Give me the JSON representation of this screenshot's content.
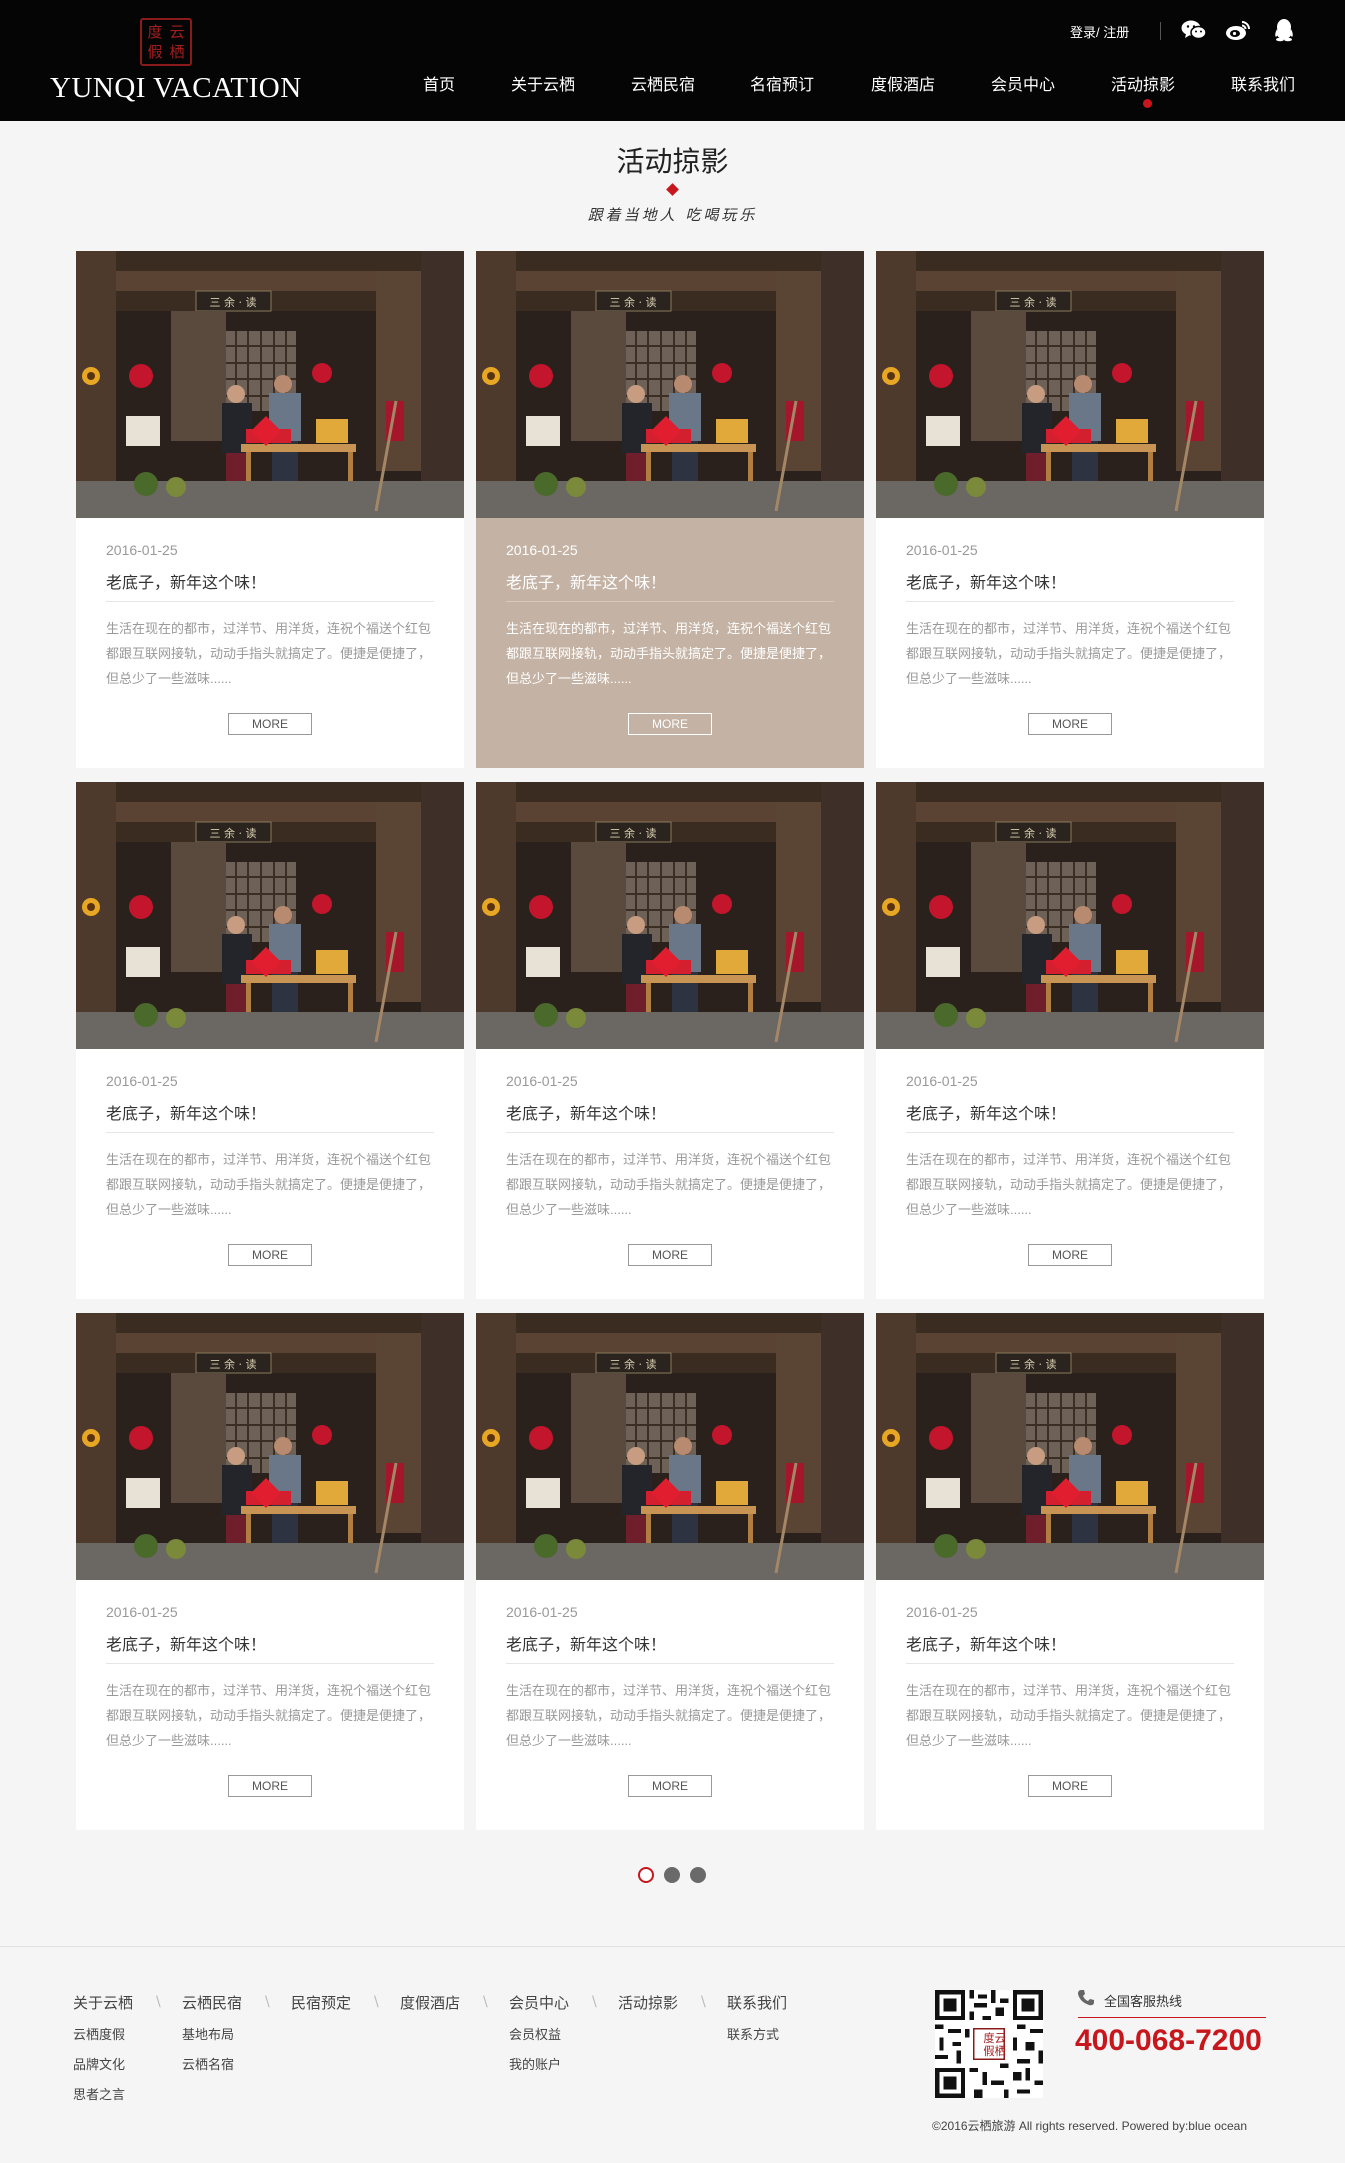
{
  "header": {
    "logo_seal": [
      "度",
      "云",
      "假",
      "栖"
    ],
    "logo_text": "YUNQI VACATION",
    "login": "登录",
    "slash": "/",
    "register": "注册",
    "icons": [
      "wechat-icon",
      "weibo-icon",
      "qq-icon"
    ]
  },
  "nav": {
    "items": [
      {
        "label": "首页"
      },
      {
        "label": "关于云栖"
      },
      {
        "label": "云栖民宿"
      },
      {
        "label": "名宿预订"
      },
      {
        "label": "度假酒店"
      },
      {
        "label": "会员中心"
      },
      {
        "label": "活动掠影"
      },
      {
        "label": "联系我们"
      }
    ],
    "active_index": 6
  },
  "page": {
    "title": "活动掠影",
    "subtitle": "跟着当地人 吃喝玩乐"
  },
  "cards": [
    {
      "date": "2016-01-25",
      "title": "老底子，新年这个味！",
      "excerpt": "生活在现在的都市，过洋节、用洋货，连祝个福送个红包都跟互联网接轨，动动手指头就搞定了。便捷是便捷了，但总少了一些滋味......",
      "more": "MORE"
    },
    {
      "date": "2016-01-25",
      "title": "老底子，新年这个味！",
      "excerpt": "生活在现在的都市，过洋节、用洋货，连祝个福送个红包都跟互联网接轨，动动手指头就搞定了。便捷是便捷了，但总少了一些滋味......",
      "more": "MORE"
    },
    {
      "date": "2016-01-25",
      "title": "老底子，新年这个味！",
      "excerpt": "生活在现在的都市，过洋节、用洋货，连祝个福送个红包都跟互联网接轨，动动手指头就搞定了。便捷是便捷了，但总少了一些滋味......",
      "more": "MORE"
    },
    {
      "date": "2016-01-25",
      "title": "老底子，新年这个味！",
      "excerpt": "生活在现在的都市，过洋节、用洋货，连祝个福送个红包都跟互联网接轨，动动手指头就搞定了。便捷是便捷了，但总少了一些滋味......",
      "more": "MORE"
    },
    {
      "date": "2016-01-25",
      "title": "老底子，新年这个味！",
      "excerpt": "生活在现在的都市，过洋节、用洋货，连祝个福送个红包都跟互联网接轨，动动手指头就搞定了。便捷是便捷了，但总少了一些滋味......",
      "more": "MORE"
    },
    {
      "date": "2016-01-25",
      "title": "老底子，新年这个味！",
      "excerpt": "生活在现在的都市，过洋节、用洋货，连祝个福送个红包都跟互联网接轨，动动手指头就搞定了。便捷是便捷了，但总少了一些滋味......",
      "more": "MORE"
    },
    {
      "date": "2016-01-25",
      "title": "老底子，新年这个味！",
      "excerpt": "生活在现在的都市，过洋节、用洋货，连祝个福送个红包都跟互联网接轨，动动手指头就搞定了。便捷是便捷了，但总少了一些滋味......",
      "more": "MORE"
    },
    {
      "date": "2016-01-25",
      "title": "老底子，新年这个味！",
      "excerpt": "生活在现在的都市，过洋节、用洋货，连祝个福送个红包都跟互联网接轨，动动手指头就搞定了。便捷是便捷了，但总少了一些滋味......",
      "more": "MORE"
    },
    {
      "date": "2016-01-25",
      "title": "老底子，新年这个味！",
      "excerpt": "生活在现在的都市，过洋节、用洋货，连祝个福送个红包都跟互联网接轨，动动手指头就搞定了。便捷是便捷了，但总少了一些滋味......",
      "more": "MORE"
    }
  ],
  "highlighted_card_index": 1,
  "pagination": {
    "pages": 3,
    "current": 1
  },
  "footer": {
    "columns": [
      {
        "head": "关于云栖",
        "items": [
          "云栖度假",
          "品牌文化",
          "思者之言"
        ]
      },
      {
        "head": "云栖民宿",
        "items": [
          "基地布局",
          "云栖名宿"
        ]
      },
      {
        "head": "民宿预定",
        "items": []
      },
      {
        "head": "度假酒店",
        "items": []
      },
      {
        "head": "会员中心",
        "items": [
          "会员权益",
          "我的账户"
        ]
      },
      {
        "head": "活动掠影",
        "items": []
      },
      {
        "head": "联系我们",
        "items": [
          "联系方式"
        ]
      }
    ],
    "separator": "\\",
    "hotline_label": "全国客服热线",
    "hotline": "400-068-7200",
    "copyright": "©2016云栖旅游 All rights reserved. Powered by:blue ocean"
  },
  "colors": {
    "accent": "#c8161d",
    "header_bg": "#050505",
    "highlight_card": "#c4b3a4",
    "page_bg": "#f5f5f5"
  }
}
